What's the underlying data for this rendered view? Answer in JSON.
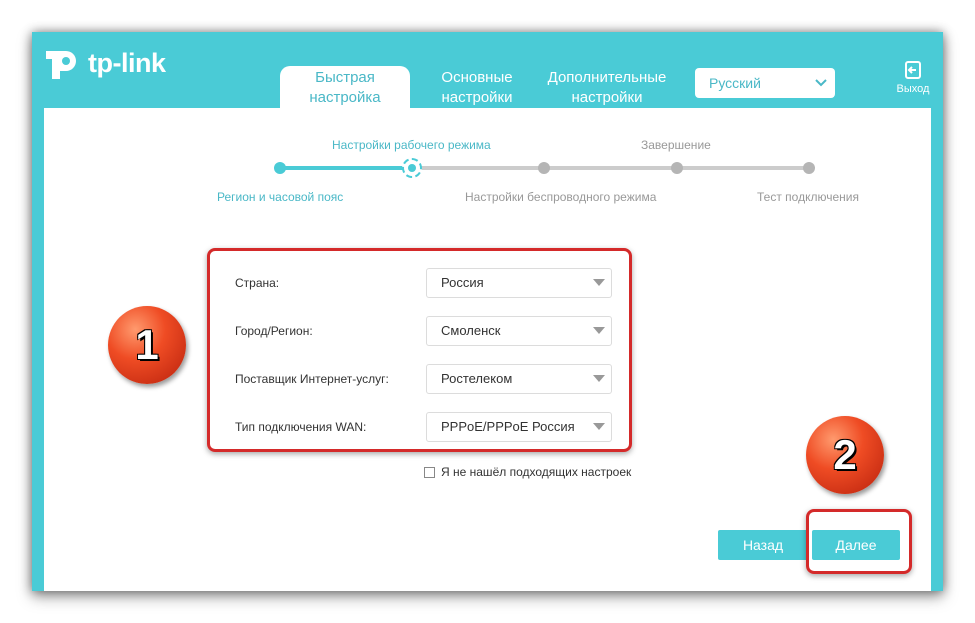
{
  "header": {
    "logo_text": "tp-link",
    "tabs": [
      {
        "line1": "Быстрая",
        "line2": "настройка"
      },
      {
        "line1": "Основные",
        "line2": "настройки"
      },
      {
        "line1": "Дополнительные",
        "line2": "настройки"
      }
    ],
    "language": "Русский",
    "logout_label": "Выход"
  },
  "wizard": {
    "top_labels": [
      "Настройки рабочего режима",
      "Завершение"
    ],
    "bottom_labels": [
      "Регион и часовой пояс",
      "Настройки беспроводного режима",
      "Тест подключения"
    ]
  },
  "form": {
    "country_label": "Страна:",
    "country_value": "Россия",
    "city_label": "Город/Регион:",
    "city_value": "Смоленск",
    "isp_label": "Поставщик Интернет-услуг:",
    "isp_value": "Ростелеком",
    "wan_label": "Тип подключения WAN:",
    "wan_value": "PPPoE/PPPoE Россия",
    "not_found_label": "Я не нашёл подходящих настроек"
  },
  "buttons": {
    "back": "Назад",
    "next": "Далее"
  },
  "badges": [
    "1",
    "2"
  ],
  "colors": {
    "accent": "#4acbd6",
    "annotation_red": "#d42a2a"
  }
}
